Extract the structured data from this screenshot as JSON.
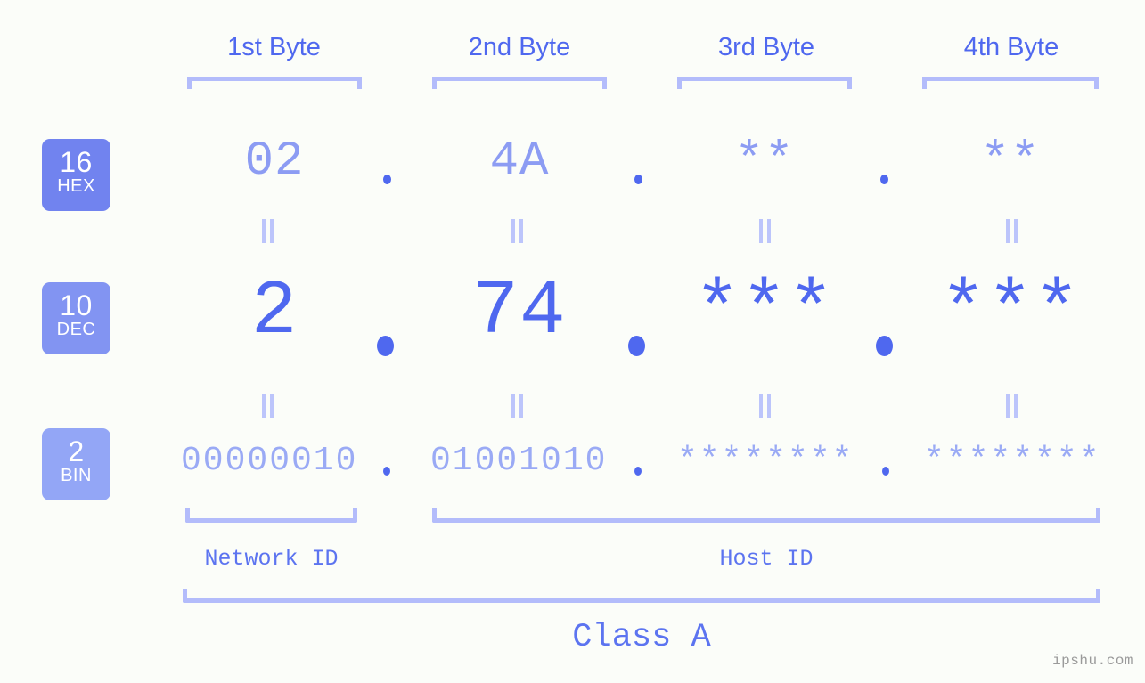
{
  "meta": {
    "watermark": "ipshu.com",
    "accent": "#4f68ef",
    "accent_light": "#b3bcfb",
    "background": "#fbfdf9"
  },
  "byte_headers": [
    {
      "label": "1st Byte"
    },
    {
      "label": "2nd Byte"
    },
    {
      "label": "3rd Byte"
    },
    {
      "label": "4th Byte"
    }
  ],
  "rows": {
    "hex": {
      "badge_number": "16",
      "badge_unit": "HEX",
      "values": [
        "02",
        "4A",
        "**",
        "**"
      ],
      "separator": "."
    },
    "dec": {
      "badge_number": "10",
      "badge_unit": "DEC",
      "values": [
        "2",
        "74",
        "***",
        "***"
      ],
      "separator": "."
    },
    "bin": {
      "badge_number": "2",
      "badge_unit": "BIN",
      "values": [
        "00000010",
        "01001010",
        "********",
        "********"
      ],
      "separator": "."
    }
  },
  "equals_marker": "=",
  "segments": {
    "network_id": "Network ID",
    "host_id": "Host ID"
  },
  "class_label": "Class A"
}
